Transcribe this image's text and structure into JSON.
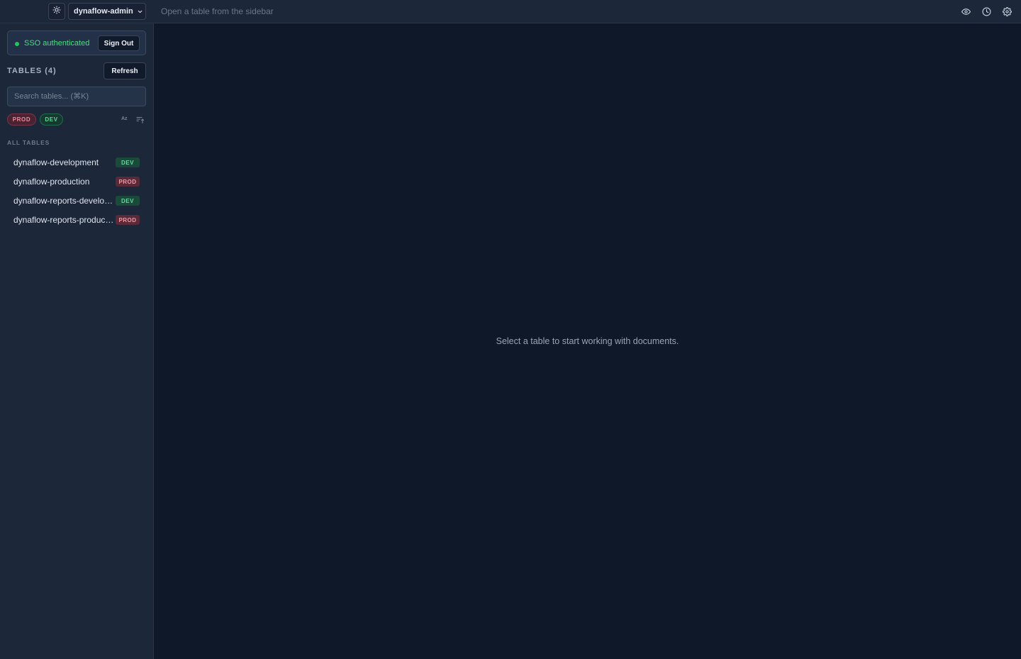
{
  "topbar": {
    "profile_name": "dynaflow-admin",
    "hint": "Open a table from the sidebar",
    "icons": [
      "sun-icon",
      "chevron-down-icon",
      "eye-icon",
      "clock-icon",
      "gear-icon"
    ]
  },
  "sidebar": {
    "sso_status": "SSO authenticated",
    "sign_out_label": "Sign Out",
    "tables_heading": "TABLES (4)",
    "refresh_label": "Refresh",
    "search_placeholder": "Search tables... (⌘K)",
    "filters": {
      "prod": "PROD",
      "dev": "DEV"
    },
    "sort_az_label": "Az",
    "section_label": "ALL TABLES",
    "tables": [
      {
        "name": "dynaflow-development",
        "env": "DEV"
      },
      {
        "name": "dynaflow-production",
        "env": "PROD"
      },
      {
        "name": "dynaflow-reports-development",
        "env": "DEV"
      },
      {
        "name": "dynaflow-reports-production",
        "env": "PROD"
      }
    ]
  },
  "main": {
    "empty_message": "Select a table to start working with documents."
  },
  "colors": {
    "background": "#0f1829",
    "panel": "#1c2739",
    "sso_green": "#22c55e",
    "prod_red": "#f08a9b",
    "dev_green": "#5fd59c"
  }
}
